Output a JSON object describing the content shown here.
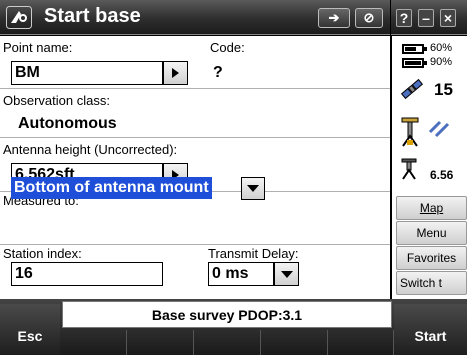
{
  "header": {
    "title": "Start base",
    "window_controls": [
      "?",
      "–",
      "×"
    ]
  },
  "form": {
    "point_name_label": "Point name:",
    "point_name_value": "BM",
    "code_label": "Code:",
    "code_value": "?",
    "observation_class_label": "Observation class:",
    "observation_class_value": "Autonomous",
    "antenna_height_label": "Antenna height (Uncorrected):",
    "antenna_height_value": "6.562sft",
    "measured_to_label": "Measured to:",
    "measured_to_value": "Bottom of antenna mount",
    "station_index_label": "Station index:",
    "station_index_value": "16",
    "transmit_delay_label": "Transmit Delay:",
    "transmit_delay_value": "0 ms"
  },
  "status_panel": {
    "battery1": "60%",
    "battery2": "90%",
    "satellites": "15",
    "antenna_height": "6.56"
  },
  "side_menu": [
    "Map",
    "Menu",
    "Favorites",
    "Switch t"
  ],
  "footer": {
    "status_text": "Base survey  PDOP:3.1",
    "left_key": "Esc",
    "right_key": "Start"
  }
}
